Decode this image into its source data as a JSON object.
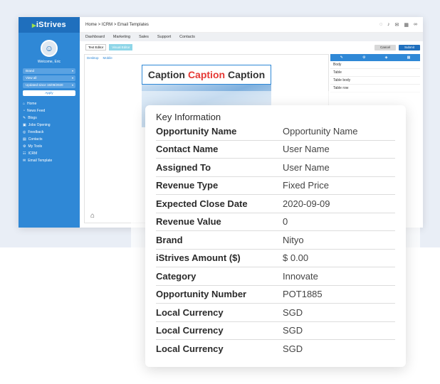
{
  "app": {
    "brand": "iStrives",
    "welcome": "Welcome, Eric",
    "sidebar_selects": [
      "Brand",
      "View all",
      "Updated since 15/09/2020"
    ],
    "apply": "Apply",
    "nav": [
      {
        "icon": "home-icon",
        "label": "Home"
      },
      {
        "icon": "news-icon",
        "label": "News Feed"
      },
      {
        "icon": "blog-icon",
        "label": "Blogs"
      },
      {
        "icon": "briefcase-icon",
        "label": "Jobs Opening"
      },
      {
        "icon": "feedback-icon",
        "label": "Feedback"
      },
      {
        "icon": "contacts-icon",
        "label": "Contacts"
      },
      {
        "icon": "tools-icon",
        "label": "My Tools"
      },
      {
        "icon": "crm-icon",
        "label": "ICRM"
      },
      {
        "icon": "email-icon",
        "label": "Email Template"
      }
    ],
    "breadcrumb": "Home  >  ICRM  >  Email Templates",
    "menu": [
      "Dashboard",
      "Marketing",
      "Sales",
      "Support",
      "Contacts"
    ],
    "tabs": [
      "Text Editor",
      "Visual Editor"
    ],
    "cancel": "Cancel",
    "submit": "Submit",
    "editor_modes": [
      "Desktop",
      "Mobile"
    ],
    "caption": {
      "a": "Caption",
      "b": "Caption",
      "c": "Caption"
    },
    "tree": [
      "Body",
      "Table",
      "Table body",
      "Table row"
    ]
  },
  "card": {
    "title": "Key Information",
    "rows": [
      {
        "label": "Opportunity Name",
        "value": "Opportunity Name"
      },
      {
        "label": "Contact Name",
        "value": "User Name"
      },
      {
        "label": "Assigned To",
        "value": "User Name"
      },
      {
        "label": "Revenue Type",
        "value": "Fixed Price"
      },
      {
        "label": "Expected Close Date",
        "value": "2020-09-09"
      },
      {
        "label": "Revenue Value",
        "value": "0"
      },
      {
        "label": "Brand",
        "value": "Nityo"
      },
      {
        "label": "iStrives Amount ($)",
        "value": "$ 0.00"
      },
      {
        "label": "Category",
        "value": "Innovate"
      },
      {
        "label": "Opportunity Number",
        "value": "POT1885"
      },
      {
        "label": "Local Currency",
        "value": "SGD"
      },
      {
        "label": "Local Currency",
        "value": "SGD"
      },
      {
        "label": "Local Currency",
        "value": "SGD"
      }
    ]
  }
}
